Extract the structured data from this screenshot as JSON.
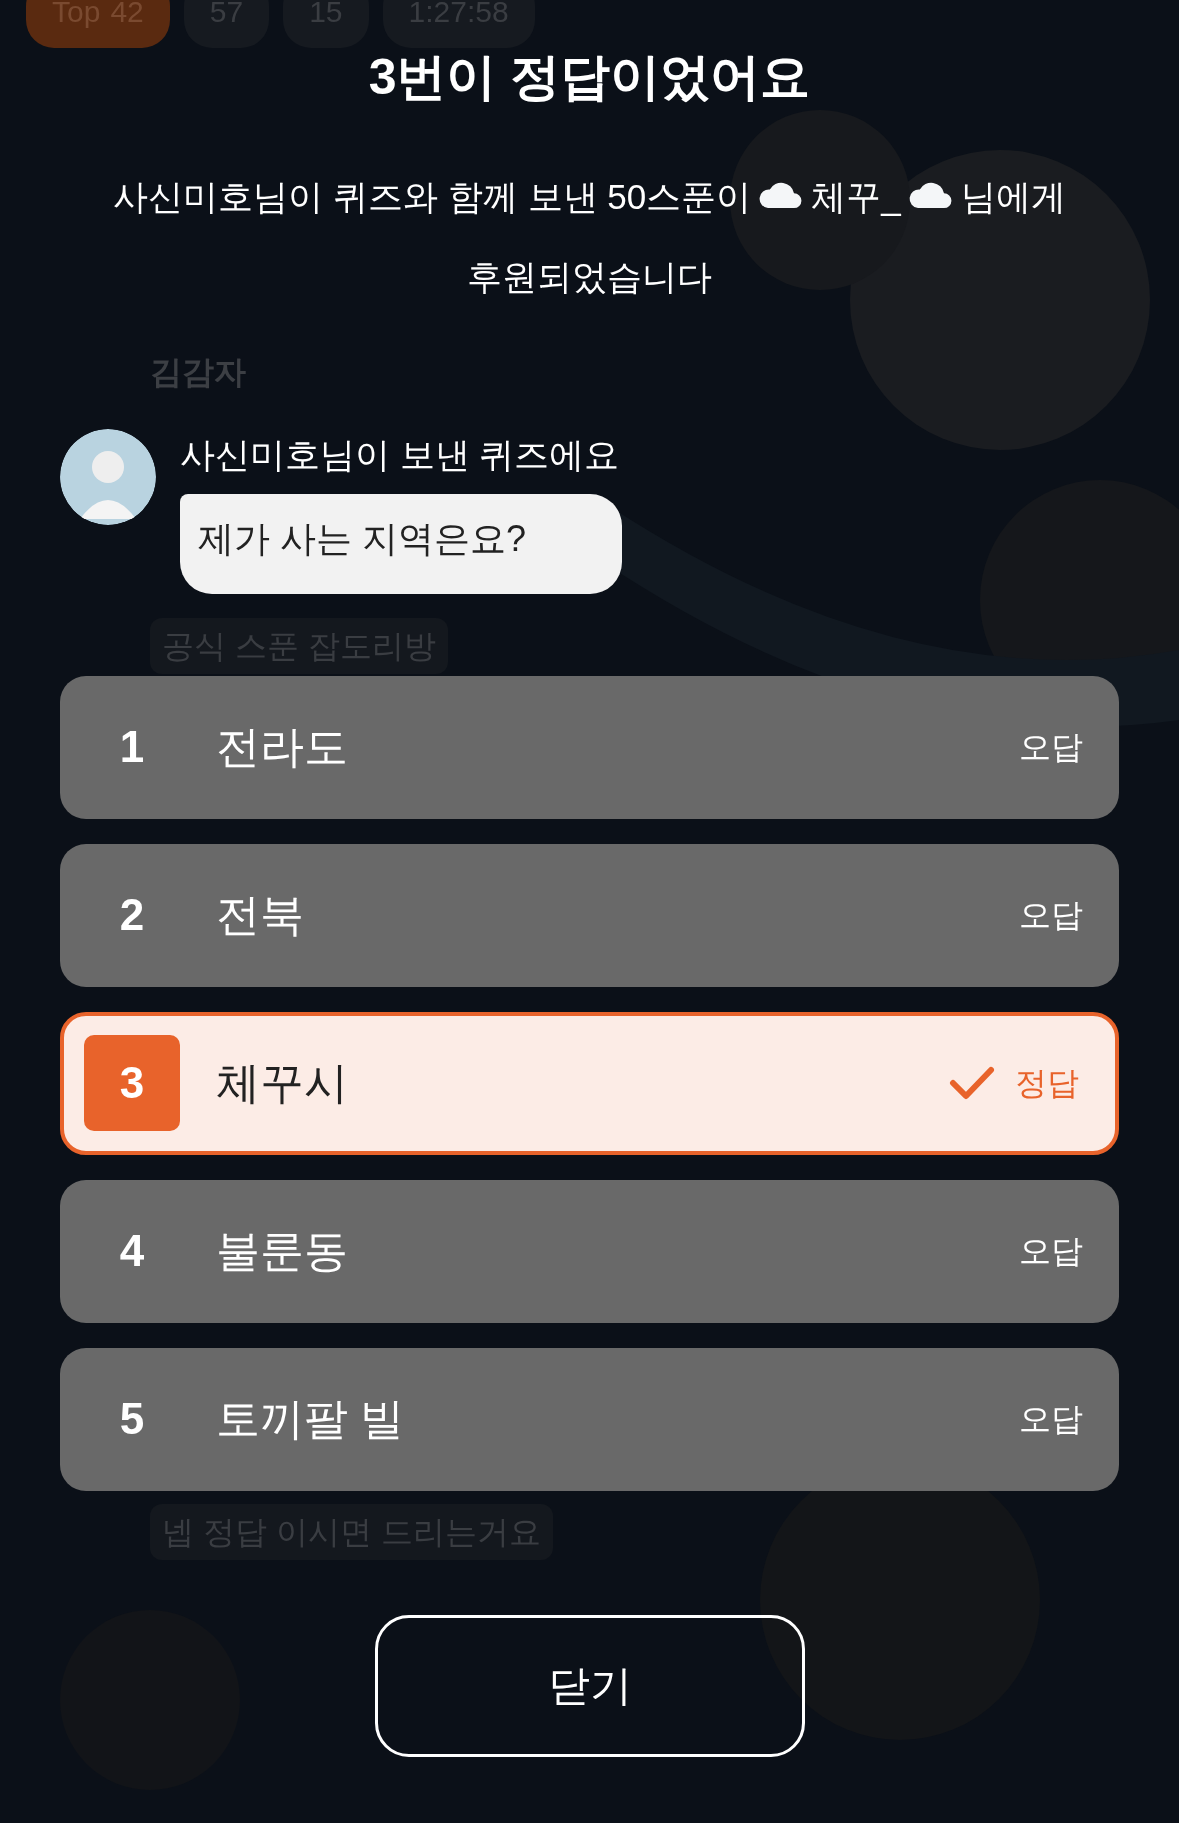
{
  "status_chips": [
    {
      "kind": "rank",
      "label": "Top",
      "value": "42"
    },
    {
      "kind": "likes",
      "value": "57"
    },
    {
      "kind": "gifts",
      "value": "15"
    },
    {
      "kind": "time",
      "value": "1:27:58"
    }
  ],
  "chat": [
    {
      "kind": "name",
      "text": "김감자"
    },
    {
      "kind": "message",
      "text": "공식 스푼 잡도리방"
    },
    {
      "kind": "message",
      "text": "넵 정답 이시면 드리는거요"
    }
  ],
  "result": {
    "title": "3번이 정답이었어요",
    "message": {
      "lead": "사신미호님이 퀴즈와 함께 보낸 50스푼이",
      "recipient": "체꾸_",
      "suffix": "님에게",
      "tail": "후원되었습니다"
    },
    "sender_line": "사신미호님이 보낸 퀴즈에요",
    "question": "제가 사는 지역은요?",
    "options": [
      {
        "number": "1",
        "label": "전라도",
        "verdict": "오답",
        "correct": false
      },
      {
        "number": "2",
        "label": "전북",
        "verdict": "오답",
        "correct": false
      },
      {
        "number": "3",
        "label": "체꾸시",
        "verdict": "정답",
        "correct": true
      },
      {
        "number": "4",
        "label": "불룬동",
        "verdict": "오답",
        "correct": false
      },
      {
        "number": "5",
        "label": "토끼팔 빌",
        "verdict": "오답",
        "correct": false
      }
    ],
    "close_button": "닫기"
  }
}
